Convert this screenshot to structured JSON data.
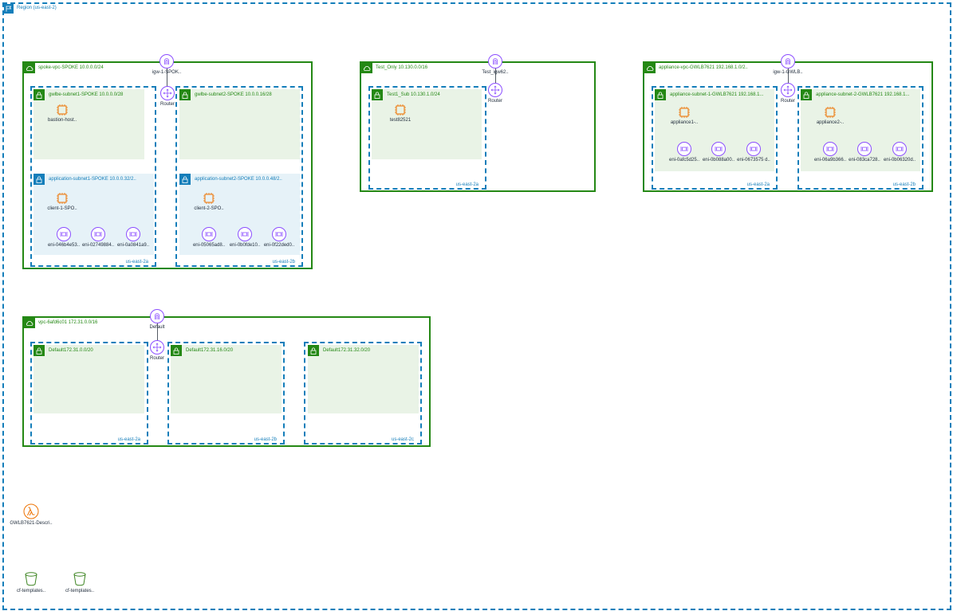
{
  "region": {
    "label": "Region (us-east-2)"
  },
  "vpcs": {
    "spoke": {
      "label": "spoke-vpc-SPOKE 10.0.0.0/24",
      "igw": "igw-1-SPOK..",
      "router": "Router",
      "az_a": "us-east-2a",
      "az_b": "us-east-2b",
      "subnets": {
        "gwlbe1": {
          "label": "gwlbe-subnet1-SPOKE 10.0.0.0/28",
          "instance": "bastion-host.."
        },
        "gwlbe2": {
          "label": "gwlbe-subnet2-SPOKE 10.0.0.16/28"
        },
        "app1": {
          "label": "application-subnet1-SPOKE 10.0.0.32/2..",
          "instance": "client-1-SPO..",
          "enis": [
            "eni-046b4e53..",
            "eni-02749884..",
            "eni-0a0841a9.."
          ]
        },
        "app2": {
          "label": "application-subnet2-SPOKE 10.0.0.48/2..",
          "instance": "client-2-SPO..",
          "enis": [
            "eni-05065ad8..",
            "eni-0b0fde10..",
            "eni-0f22ded0.."
          ]
        }
      }
    },
    "test": {
      "label": "Test_Only 10.130.0.0/16",
      "igw": "Test_igw62..",
      "router": "Router",
      "az_a": "us-east-2a",
      "subnet": {
        "label": "Test1_Sub 10.130.1.0/24",
        "instance": "test82521"
      }
    },
    "appliance": {
      "label": "appliance-vpc-GWLB7621 192.168.1.0/2..",
      "igw": "igw-1-GWLB..",
      "router": "Router",
      "az_a": "us-east-2a",
      "az_b": "us-east-2b",
      "subnets": {
        "s1": {
          "label": "appliance-subnet-1-GWLB7621 192.168.1...",
          "instance": "appliance1-..",
          "enis": [
            "eni-0afc5d25..",
            "eni-0b088a00..",
            "eni-0673575 d.."
          ]
        },
        "s2": {
          "label": "appliance-subnet-2-GWLB7621 192.168.1...",
          "instance": "appliance2-..",
          "enis": [
            "eni-06a9b366..",
            "eni-083ca728..",
            "eni-0b06320d.."
          ]
        }
      }
    },
    "default": {
      "label": "vpc-6afd6c01 172.31.0.0/16",
      "igw": "Default",
      "router": "Router",
      "az_a": "us-east-2a",
      "az_b": "us-east-2b",
      "az_c": "us-east-2c",
      "subnets": {
        "a": {
          "label": "Default172.31.0.0/20"
        },
        "b": {
          "label": "Default172.31.16.0/20"
        },
        "c": {
          "label": "Default172.31.32.0/20"
        }
      }
    }
  },
  "lambda": {
    "label": "GWLB7621-Descri.."
  },
  "buckets": [
    "cf-templates..",
    "cf-templates.."
  ],
  "colors": {
    "region": "#147eba",
    "vpc": "#248814",
    "ec2": "#ed7100",
    "eni": "#8c4fff",
    "lambda": "#ed7100",
    "s3": "#3f8624"
  }
}
